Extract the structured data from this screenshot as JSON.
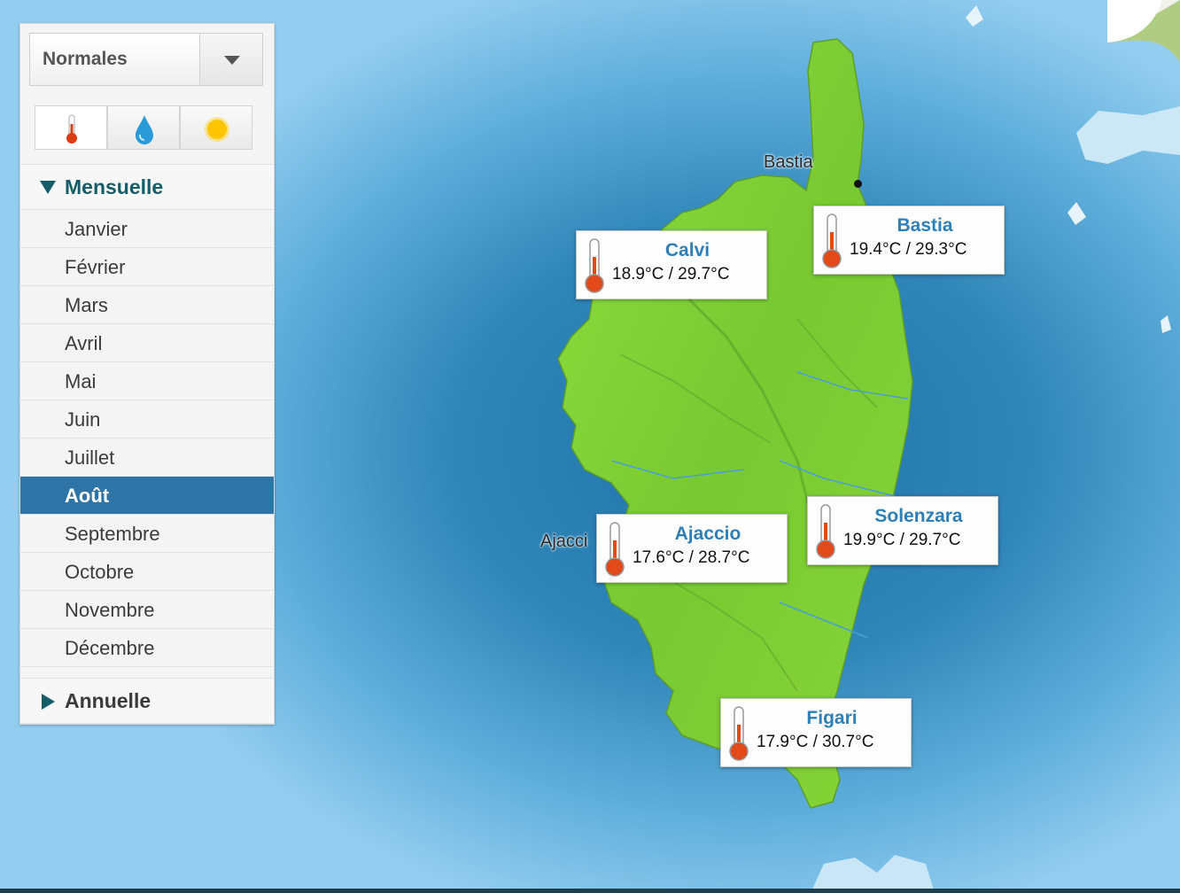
{
  "selector": {
    "value": "Normales"
  },
  "tabs": [
    {
      "icon": "thermometer-icon",
      "active": true
    },
    {
      "icon": "water-drop-icon",
      "active": false
    },
    {
      "icon": "sun-icon",
      "active": false
    }
  ],
  "sections": {
    "monthly": {
      "label": "Mensuelle",
      "expanded": true
    },
    "annual": {
      "label": "Annuelle",
      "expanded": false
    }
  },
  "months": [
    "Janvier",
    "Février",
    "Mars",
    "Avril",
    "Mai",
    "Juin",
    "Juillet",
    "Août",
    "Septembre",
    "Octobre",
    "Novembre",
    "Décembre"
  ],
  "selected_month": "Août",
  "map": {
    "labels": {
      "bastia": "Bastia",
      "ajaccio": "Ajacci"
    },
    "stations": [
      {
        "name": "Calvi",
        "temps": "18.9°C / 29.7°C"
      },
      {
        "name": "Bastia",
        "temps": "19.4°C / 29.3°C"
      },
      {
        "name": "Ajaccio",
        "temps": "17.6°C / 28.7°C"
      },
      {
        "name": "Solenzara",
        "temps": "19.9°C / 29.7°C"
      },
      {
        "name": "Figari",
        "temps": "17.9°C / 30.7°C"
      }
    ]
  },
  "colors": {
    "sea": "#8ec8ec",
    "deep_sea": "#2f86b8",
    "land": "#7fd23a",
    "active_month": "#2e74a6",
    "station_name": "#2f7fb7",
    "section_text": "#135c68"
  }
}
